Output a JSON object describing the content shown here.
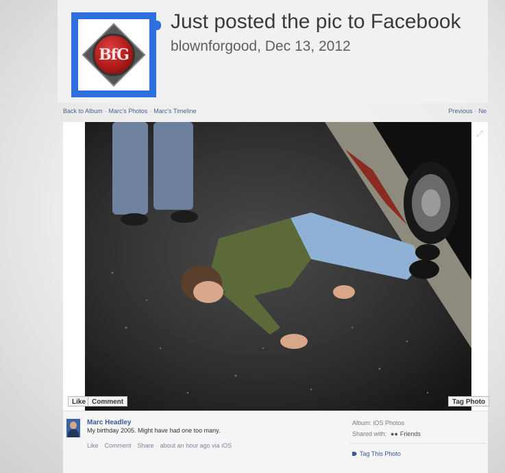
{
  "post": {
    "title": "Just posted the pic to Facebook",
    "byline": "blownforgood, Dec 13, 2012",
    "logo_text": "BfG"
  },
  "nav": {
    "back_to_album": "Back to Album",
    "separator": "·",
    "marcs_photos": "Marc's Photos",
    "marcs_timeline": "Marc's Timeline",
    "previous": "Previous",
    "next": "Ne"
  },
  "photo": {
    "description_icon": "expand-icon"
  },
  "photo_buttons": {
    "like": "Like",
    "comment": "Comment",
    "tag_photo": "Tag Photo"
  },
  "footer": {
    "author": "Marc Headley",
    "caption": "My birthday 2005. Might have had one too many.",
    "actions": {
      "like": "Like",
      "comment": "Comment",
      "share": "Share",
      "timestamp": "about an hour ago via iOS",
      "separator": "·"
    },
    "album_line": "Album: iOS Photos",
    "shared_with_label": "Shared with:",
    "shared_with_value": "Friends",
    "tag_this_photo": "Tag This Photo"
  },
  "colors": {
    "logo_border": "#2e6fe0",
    "link_blue": "#3b5998"
  }
}
